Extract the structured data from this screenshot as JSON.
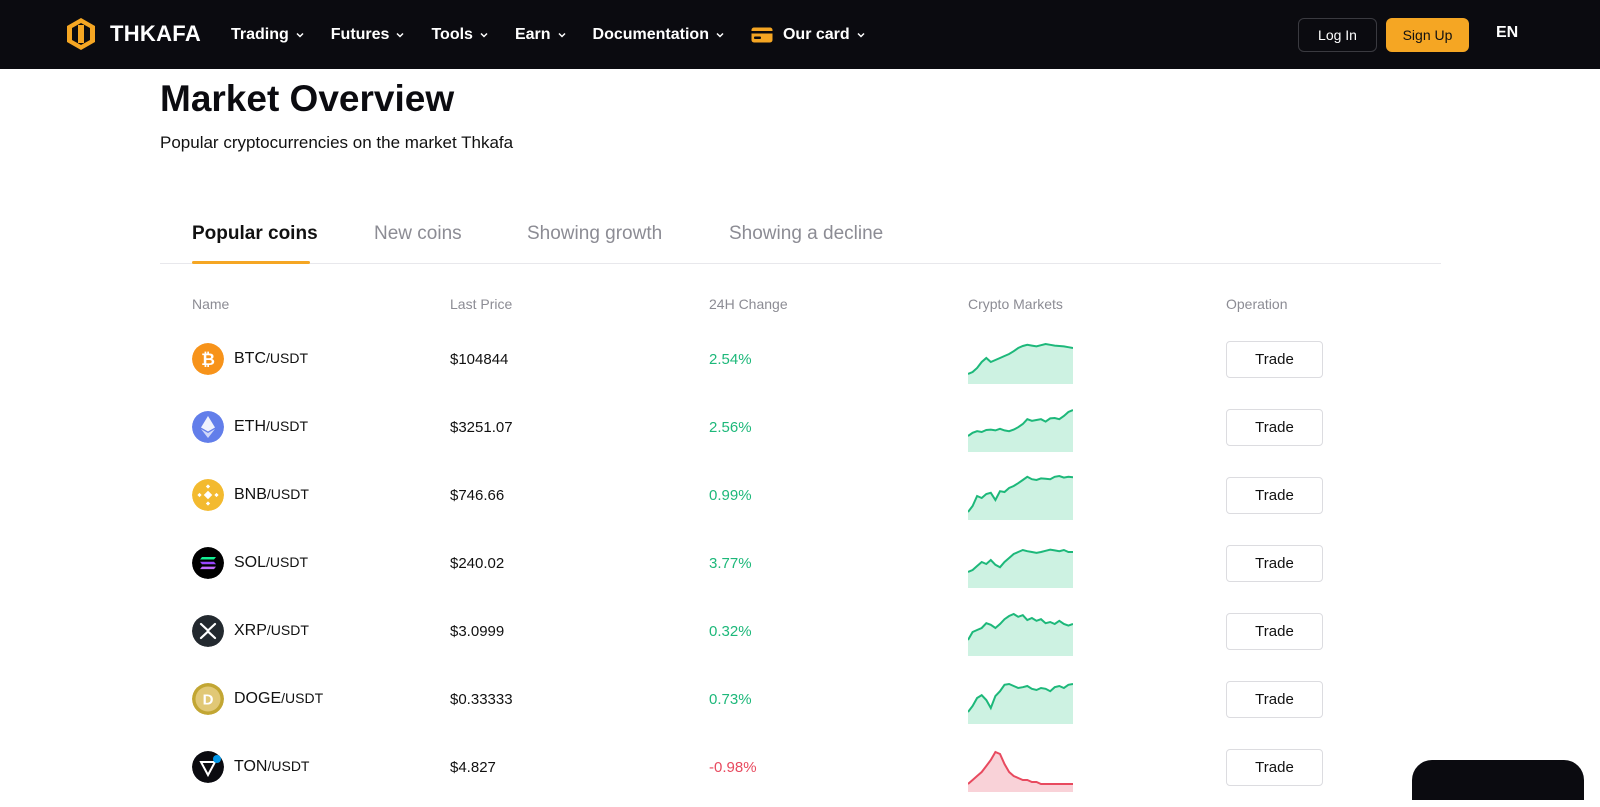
{
  "brand": {
    "name": "THKAFA",
    "accent": "#f5a623"
  },
  "nav": {
    "items": [
      {
        "label": "Trading"
      },
      {
        "label": "Futures"
      },
      {
        "label": "Tools"
      },
      {
        "label": "Earn"
      },
      {
        "label": "Documentation"
      },
      {
        "label": "Our card",
        "icon": "card-icon"
      }
    ],
    "login_label": "Log In",
    "signup_label": "Sign Up",
    "language": "EN"
  },
  "page": {
    "title": "Market Overview",
    "subtitle": "Popular cryptocurrencies on the market Thkafa"
  },
  "tabs": [
    {
      "label": "Popular coins",
      "active": true
    },
    {
      "label": "New coins"
    },
    {
      "label": "Showing growth"
    },
    {
      "label": "Showing a decline"
    }
  ],
  "table": {
    "columns": [
      "Name",
      "Last Price",
      "24H Change",
      "Crypto Markets",
      "Operation"
    ],
    "trade_label": "Trade",
    "rows": [
      {
        "base": "BTC",
        "quote": "/USDT",
        "price": "$104844",
        "change": "2.54%",
        "trend": "up",
        "icon": "bitcoin-icon",
        "spark": [
          0.15,
          0.2,
          0.3,
          0.45,
          0.55,
          0.45,
          0.5,
          0.55,
          0.6,
          0.65,
          0.72,
          0.8,
          0.85,
          0.88,
          0.86,
          0.84,
          0.87,
          0.9,
          0.88,
          0.86,
          0.85,
          0.84,
          0.82,
          0.8
        ]
      },
      {
        "base": "ETH",
        "quote": "/USDT",
        "price": "$3251.07",
        "change": "2.56%",
        "trend": "up",
        "icon": "ethereum-icon",
        "spark": [
          0.3,
          0.38,
          0.42,
          0.4,
          0.45,
          0.46,
          0.44,
          0.48,
          0.44,
          0.42,
          0.46,
          0.52,
          0.6,
          0.72,
          0.68,
          0.7,
          0.72,
          0.66,
          0.74,
          0.75,
          0.72,
          0.8,
          0.9,
          0.95
        ]
      },
      {
        "base": "BNB",
        "quote": "/USDT",
        "price": "$746.66",
        "change": "0.99%",
        "trend": "up",
        "icon": "bnb-icon",
        "spark": [
          0.1,
          0.25,
          0.5,
          0.45,
          0.55,
          0.58,
          0.4,
          0.62,
          0.6,
          0.7,
          0.75,
          0.82,
          0.9,
          0.98,
          0.92,
          0.9,
          0.94,
          0.93,
          0.92,
          0.98,
          1.0,
          0.96,
          0.98,
          0.97
        ]
      },
      {
        "base": "SOL",
        "quote": "/USDT",
        "price": "$240.02",
        "change": "3.77%",
        "trend": "up",
        "icon": "solana-icon",
        "spark": [
          0.3,
          0.35,
          0.45,
          0.55,
          0.5,
          0.6,
          0.48,
          0.42,
          0.55,
          0.65,
          0.75,
          0.8,
          0.85,
          0.82,
          0.8,
          0.78,
          0.8,
          0.83,
          0.86,
          0.84,
          0.82,
          0.85,
          0.8,
          0.8
        ]
      },
      {
        "base": "XRP",
        "quote": "/USDT",
        "price": "$3.0999",
        "change": "0.32%",
        "trend": "up",
        "icon": "xrp-icon",
        "spark": [
          0.3,
          0.5,
          0.55,
          0.6,
          0.72,
          0.68,
          0.6,
          0.7,
          0.82,
          0.9,
          0.95,
          0.88,
          0.92,
          0.8,
          0.85,
          0.78,
          0.82,
          0.72,
          0.75,
          0.7,
          0.78,
          0.7,
          0.66,
          0.7
        ]
      },
      {
        "base": "DOGE",
        "quote": "/USDT",
        "price": "$0.33333",
        "change": "0.73%",
        "trend": "up",
        "icon": "dogecoin-icon",
        "spark": [
          0.2,
          0.35,
          0.55,
          0.62,
          0.5,
          0.3,
          0.6,
          0.72,
          0.88,
          0.9,
          0.85,
          0.8,
          0.82,
          0.85,
          0.78,
          0.75,
          0.8,
          0.78,
          0.72,
          0.82,
          0.85,
          0.8,
          0.88,
          0.9
        ]
      },
      {
        "base": "TON",
        "quote": "/USDT",
        "price": "$4.827",
        "change": "-0.98%",
        "trend": "down",
        "icon": "toncoin-icon",
        "spark": [
          0.1,
          0.2,
          0.3,
          0.4,
          0.55,
          0.7,
          0.9,
          0.85,
          0.6,
          0.4,
          0.3,
          0.25,
          0.2,
          0.2,
          0.15,
          0.15,
          0.1,
          0.1,
          0.1,
          0.1,
          0.1,
          0.1,
          0.1,
          0.1
        ]
      }
    ]
  },
  "colors": {
    "up": "#1db87a",
    "down": "#e84a5f",
    "up_fill": "#cdf2e2",
    "down_fill": "#f9d2d8"
  }
}
